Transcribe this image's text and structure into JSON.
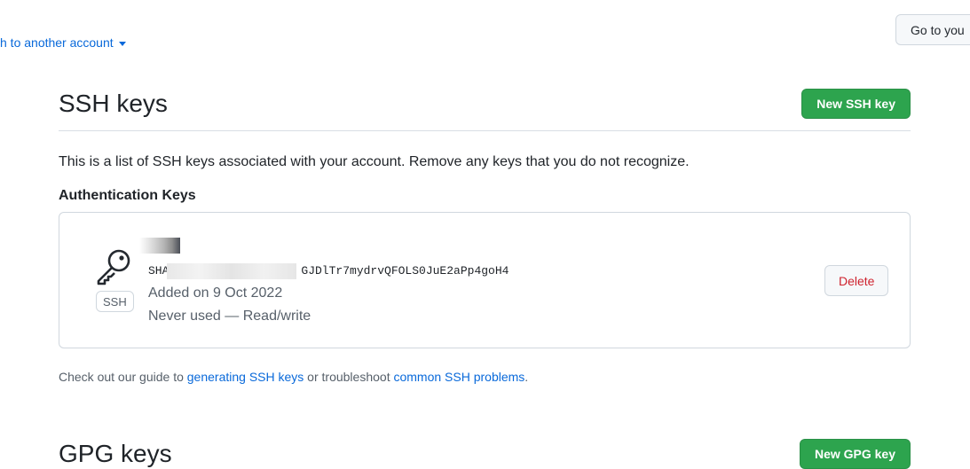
{
  "top": {
    "switch_account": "h to another account",
    "goto_button": "Go to you"
  },
  "ssh": {
    "title": "SSH keys",
    "new_button": "New SSH key",
    "intro": "This is a list of SSH keys associated with your account. Remove any keys that you do not recognize.",
    "auth_heading": "Authentication Keys",
    "key": {
      "badge": "SSH",
      "fingerprint_prefix": "SHA",
      "fingerprint_visible": "GJDlTr7mydrvQFOLS0JuE2aPp4goH4",
      "added": "Added on 9 Oct 2022",
      "usage": "Never used — Read/write",
      "delete_label": "Delete"
    },
    "guide": {
      "prefix": "Check out our guide to ",
      "link1": "generating SSH keys",
      "middle": " or troubleshoot ",
      "link2": "common SSH problems",
      "suffix": "."
    }
  },
  "gpg": {
    "title": "GPG keys",
    "new_button": "New GPG key"
  },
  "colors": {
    "accent_blue": "#0969da",
    "button_green": "#2da44e",
    "danger_red": "#cf222e"
  },
  "icons": [
    "caret-down-icon",
    "key-icon"
  ]
}
